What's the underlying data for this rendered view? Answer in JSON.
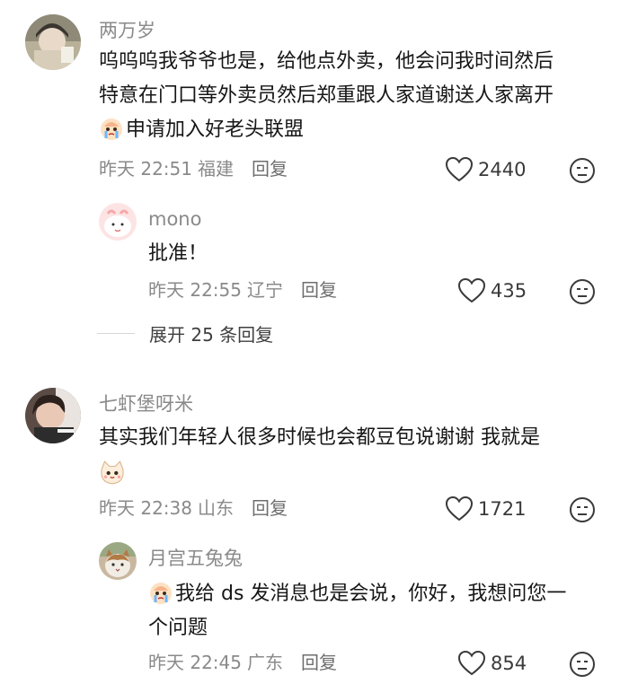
{
  "comments": [
    {
      "username": "两万岁",
      "lines": [
        "呜呜呜我爷爷也是，给他点外卖，他会问我时间然后",
        "特意在门口等外卖员然后郑重跟人家道谢送人家离开",
        "申请加入好老头联盟"
      ],
      "time": "昨天 22:51",
      "location": "福建",
      "reply_label": "回复",
      "likes": "2440",
      "emoji": "crying-emoji",
      "replies": [
        {
          "username": "mono",
          "lines": [
            "批准！"
          ],
          "time": "昨天 22:55",
          "location": "辽宁",
          "reply_label": "回复",
          "likes": "435"
        }
      ],
      "expand_label": "展开 25 条回复"
    },
    {
      "username": "七虾堡呀米",
      "lines": [
        "其实我们年轻人很多时候也会都豆包说谢谢 我就是"
      ],
      "time": "昨天 22:38",
      "location": "山东",
      "reply_label": "回复",
      "likes": "1721",
      "emoji": "cat-emoji",
      "replies": [
        {
          "username": "月宫五兔兔",
          "lines": [
            "我给 ds 发消息也是会说，你好，我想问您一",
            "个问题"
          ],
          "time": "昨天 22:45",
          "location": "广东",
          "reply_label": "回复",
          "likes": "854",
          "emoji": "crying-emoji"
        }
      ]
    }
  ],
  "icons": {
    "like": "heart-icon",
    "dislike": "dislike-face-icon"
  },
  "colors": {
    "text": "#161616",
    "meta": "#8a8a8a",
    "icon": "#3a3a3a"
  }
}
